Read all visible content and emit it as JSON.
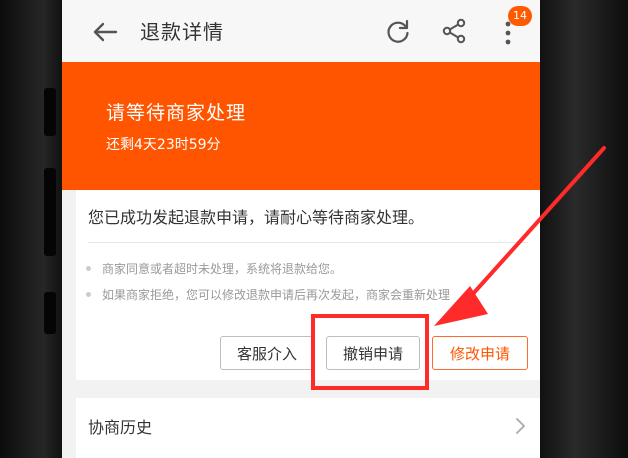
{
  "header": {
    "title": "退款详情",
    "back_icon": "back-arrow-icon",
    "refresh_icon": "refresh-icon",
    "share_icon": "share-icon",
    "more_icon": "more-icon",
    "badge_count": "14",
    "badge_color": "#ff5a00"
  },
  "status": {
    "title": "请等待商家处理",
    "time_remaining": "还剩4天23时59分",
    "background": "#ff5500"
  },
  "card": {
    "notice": "您已成功发起退款申请，请耐心等待商家处理。",
    "tips": [
      "商家同意或者超时未处理，系统将退款给您。",
      "如果商家拒绝，您可以修改退款申请后再次发起，商家会重新处理"
    ],
    "buttons": {
      "customer_service": "客服介入",
      "cancel": "撤销申请",
      "modify": "修改申请"
    }
  },
  "history": {
    "label": "协商历史",
    "chevron_icon": "chevron-right-icon"
  },
  "annotation": {
    "color": "#ff2a2a"
  }
}
